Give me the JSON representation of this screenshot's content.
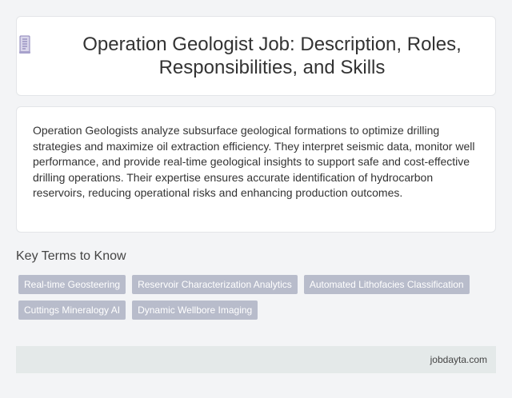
{
  "header": {
    "icon": "document-icon",
    "title": "Operation Geologist Job: Description, Roles, Responsibilities, and Skills"
  },
  "description": "Operation Geologists analyze subsurface geological formations to optimize drilling strategies and maximize oil extraction efficiency. They interpret seismic data, monitor well performance, and provide real-time geological insights to support safe and cost-effective drilling operations. Their expertise ensures accurate identification of hydrocarbon reservoirs, reducing operational risks and enhancing production outcomes.",
  "key_terms": {
    "heading": "Key Terms to Know",
    "tags": [
      "Real-time Geosteering",
      "Reservoir Characterization Analytics",
      "Automated Lithofacies Classification",
      "Cuttings Mineralogy AI",
      "Dynamic Wellbore Imaging"
    ]
  },
  "footer": {
    "site": "jobdayta.com"
  },
  "colors": {
    "tag_bg": "#b8bccb",
    "footer_bg": "#e4e9e9",
    "icon_accent": "#8a83b8"
  }
}
